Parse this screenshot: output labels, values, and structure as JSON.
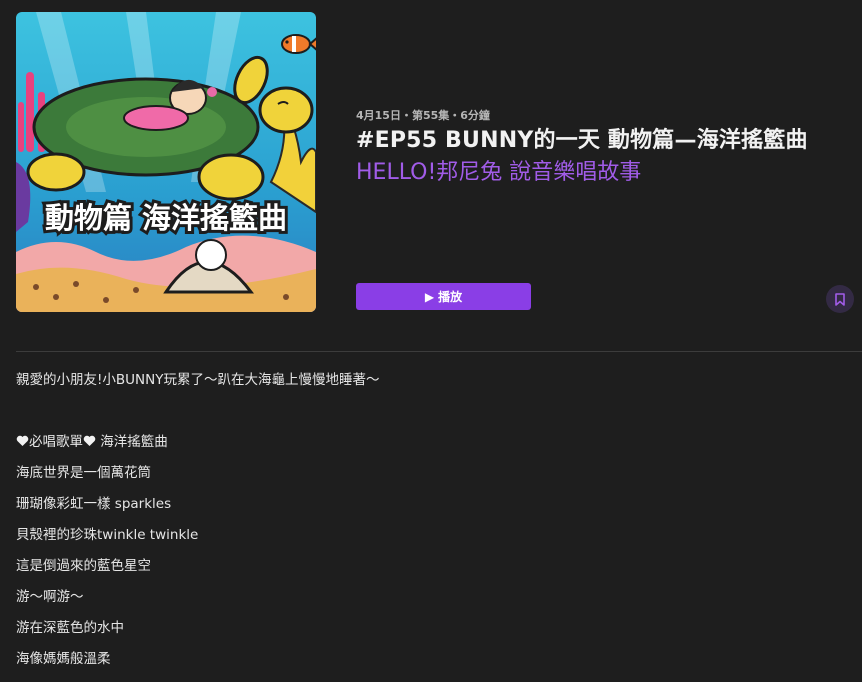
{
  "episode": {
    "meta": "4月15日・第55集・6分鐘",
    "title": "#EP55 BUNNY的一天 動物篇—海洋搖籃曲",
    "show_name": "HELLO!邦尼兔 說音樂唱故事",
    "artwork_caption": "動物篇 海洋搖籃曲"
  },
  "actions": {
    "play_label": "播放",
    "play_icon": "play-icon",
    "bookmark_icon": "bookmark-icon"
  },
  "description": {
    "intro": "親愛的小朋友!小BUNNY玩累了～趴在大海龜上慢慢地睡著～",
    "lyrics_heading": "必唱歌單",
    "lyrics_heading_song": "海洋搖籃曲",
    "lines": [
      "海底世界是一個萬花筒",
      "珊瑚像彩虹一樣 sparkles",
      "貝殼裡的珍珠twinkle twinkle",
      "這是倒過來的藍色星空",
      "游～啊游～",
      "游在深藍色的水中",
      "海像媽媽般溫柔"
    ]
  },
  "colors": {
    "background": "#1e1e1e",
    "accent": "#8a3ee6",
    "show_name": "#a15ce8"
  }
}
